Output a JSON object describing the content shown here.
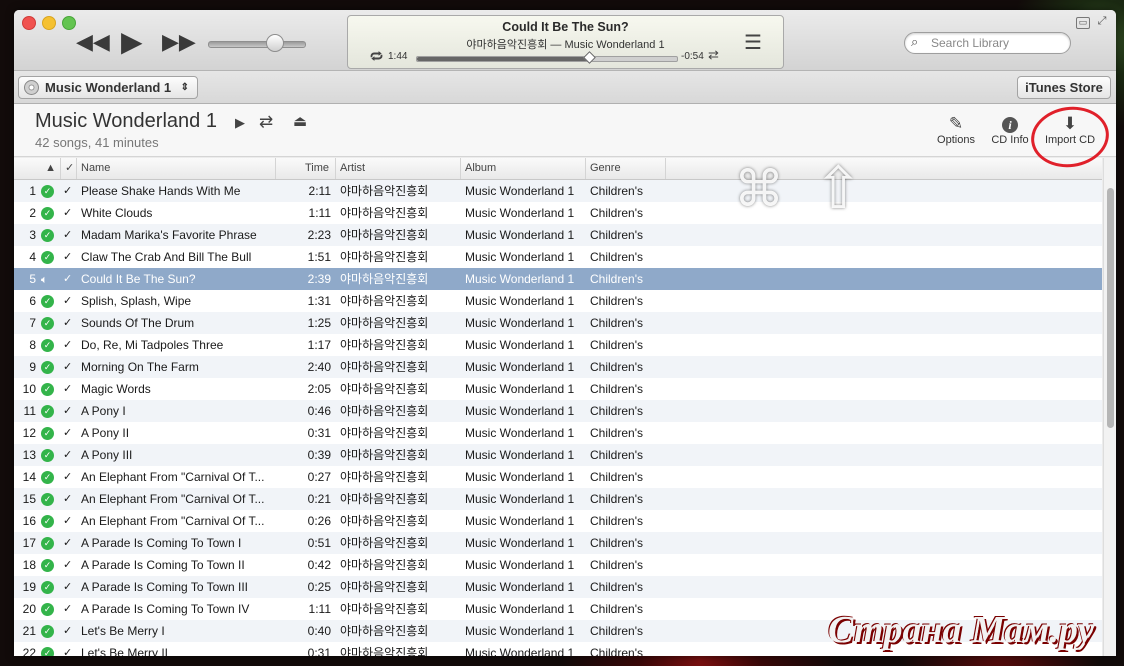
{
  "player": {
    "now_playing_title": "Could It Be The Sun?",
    "now_playing_sub": "야마하음악진흥회 — Music Wonderland 1",
    "elapsed": "1:44",
    "remaining": "-0:54",
    "progress": 0.66,
    "volume": 0.6
  },
  "search": {
    "placeholder": "Search Library"
  },
  "source": {
    "label": "Music Wonderland 1",
    "arrows": "⇕"
  },
  "store_button": "iTunes Store",
  "album": {
    "title": "Music Wonderland 1",
    "summary": "42 songs, 41 minutes"
  },
  "toolbar": {
    "options": "Options",
    "cd_info": "CD Info",
    "import": "Import CD"
  },
  "columns": {
    "sort_arrow": "▲",
    "check": "✓",
    "name": "Name",
    "time": "Time",
    "artist": "Artist",
    "album": "Album",
    "genre": "Genre"
  },
  "tracks": [
    {
      "num": "1",
      "name": "Please Shake Hands With Me",
      "time": "2:11",
      "artist": "야마하음악진흥회",
      "album": "Music Wonderland 1",
      "genre": "Children's"
    },
    {
      "num": "2",
      "name": "White Clouds",
      "time": "1:11",
      "artist": "야마하음악진흥회",
      "album": "Music Wonderland 1",
      "genre": "Children's"
    },
    {
      "num": "3",
      "name": "Madam Marika's Favorite Phrase",
      "time": "2:23",
      "artist": "야마하음악진흥회",
      "album": "Music Wonderland 1",
      "genre": "Children's"
    },
    {
      "num": "4",
      "name": "Claw The Crab And Bill The Bull",
      "time": "1:51",
      "artist": "야마하음악진흥회",
      "album": "Music Wonderland 1",
      "genre": "Children's"
    },
    {
      "num": "5",
      "name": "Could It Be The Sun?",
      "time": "2:39",
      "artist": "야마하음악진흥회",
      "album": "Music Wonderland 1",
      "genre": "Children's",
      "playing": true
    },
    {
      "num": "6",
      "name": "Splish, Splash, Wipe",
      "time": "1:31",
      "artist": "야마하음악진흥회",
      "album": "Music Wonderland 1",
      "genre": "Children's"
    },
    {
      "num": "7",
      "name": "Sounds Of The Drum",
      "time": "1:25",
      "artist": "야마하음악진흥회",
      "album": "Music Wonderland 1",
      "genre": "Children's"
    },
    {
      "num": "8",
      "name": "Do, Re, Mi Tadpoles Three",
      "time": "1:17",
      "artist": "야마하음악진흥회",
      "album": "Music Wonderland 1",
      "genre": "Children's"
    },
    {
      "num": "9",
      "name": "Morning On The Farm",
      "time": "2:40",
      "artist": "야마하음악진흥회",
      "album": "Music Wonderland 1",
      "genre": "Children's"
    },
    {
      "num": "10",
      "name": "Magic Words",
      "time": "2:05",
      "artist": "야마하음악진흥회",
      "album": "Music Wonderland 1",
      "genre": "Children's"
    },
    {
      "num": "11",
      "name": "A Pony I",
      "time": "0:46",
      "artist": "야마하음악진흥회",
      "album": "Music Wonderland 1",
      "genre": "Children's"
    },
    {
      "num": "12",
      "name": "A Pony II",
      "time": "0:31",
      "artist": "야마하음악진흥회",
      "album": "Music Wonderland 1",
      "genre": "Children's"
    },
    {
      "num": "13",
      "name": "A Pony III",
      "time": "0:39",
      "artist": "야마하음악진흥회",
      "album": "Music Wonderland 1",
      "genre": "Children's"
    },
    {
      "num": "14",
      "name": "An Elephant From \"Carnival Of T...",
      "time": "0:27",
      "artist": "야마하음악진흥회",
      "album": "Music Wonderland 1",
      "genre": "Children's"
    },
    {
      "num": "15",
      "name": "An Elephant From \"Carnival Of T...",
      "time": "0:21",
      "artist": "야마하음악진흥회",
      "album": "Music Wonderland 1",
      "genre": "Children's"
    },
    {
      "num": "16",
      "name": "An Elephant From \"Carnival Of T...",
      "time": "0:26",
      "artist": "야마하음악진흥회",
      "album": "Music Wonderland 1",
      "genre": "Children's"
    },
    {
      "num": "17",
      "name": "A Parade Is Coming To Town I",
      "time": "0:51",
      "artist": "야마하음악진흥회",
      "album": "Music Wonderland 1",
      "genre": "Children's"
    },
    {
      "num": "18",
      "name": "A Parade Is Coming To Town II",
      "time": "0:42",
      "artist": "야마하음악진흥회",
      "album": "Music Wonderland 1",
      "genre": "Children's"
    },
    {
      "num": "19",
      "name": "A Parade Is Coming To Town III",
      "time": "0:25",
      "artist": "야마하음악진흥회",
      "album": "Music Wonderland 1",
      "genre": "Children's"
    },
    {
      "num": "20",
      "name": "A Parade Is Coming To Town IV",
      "time": "1:11",
      "artist": "야마하음악진흥회",
      "album": "Music Wonderland 1",
      "genre": "Children's"
    },
    {
      "num": "21",
      "name": "Let's Be Merry I",
      "time": "0:40",
      "artist": "야마하음악진흥회",
      "album": "Music Wonderland 1",
      "genre": "Children's"
    },
    {
      "num": "22",
      "name": "Let's Be Merry II",
      "time": "0:31",
      "artist": "야마하음악진흥회",
      "album": "Music Wonderland 1",
      "genre": "Children's"
    }
  ],
  "overlay": {
    "command_glyph": "⌘",
    "shift_glyph": "⇧"
  },
  "watermark": "Страна Мам.ру",
  "colors": {
    "selected_row": "#8fa9c9",
    "check_green": "#33b44a",
    "annotation_red": "#e0202a"
  }
}
